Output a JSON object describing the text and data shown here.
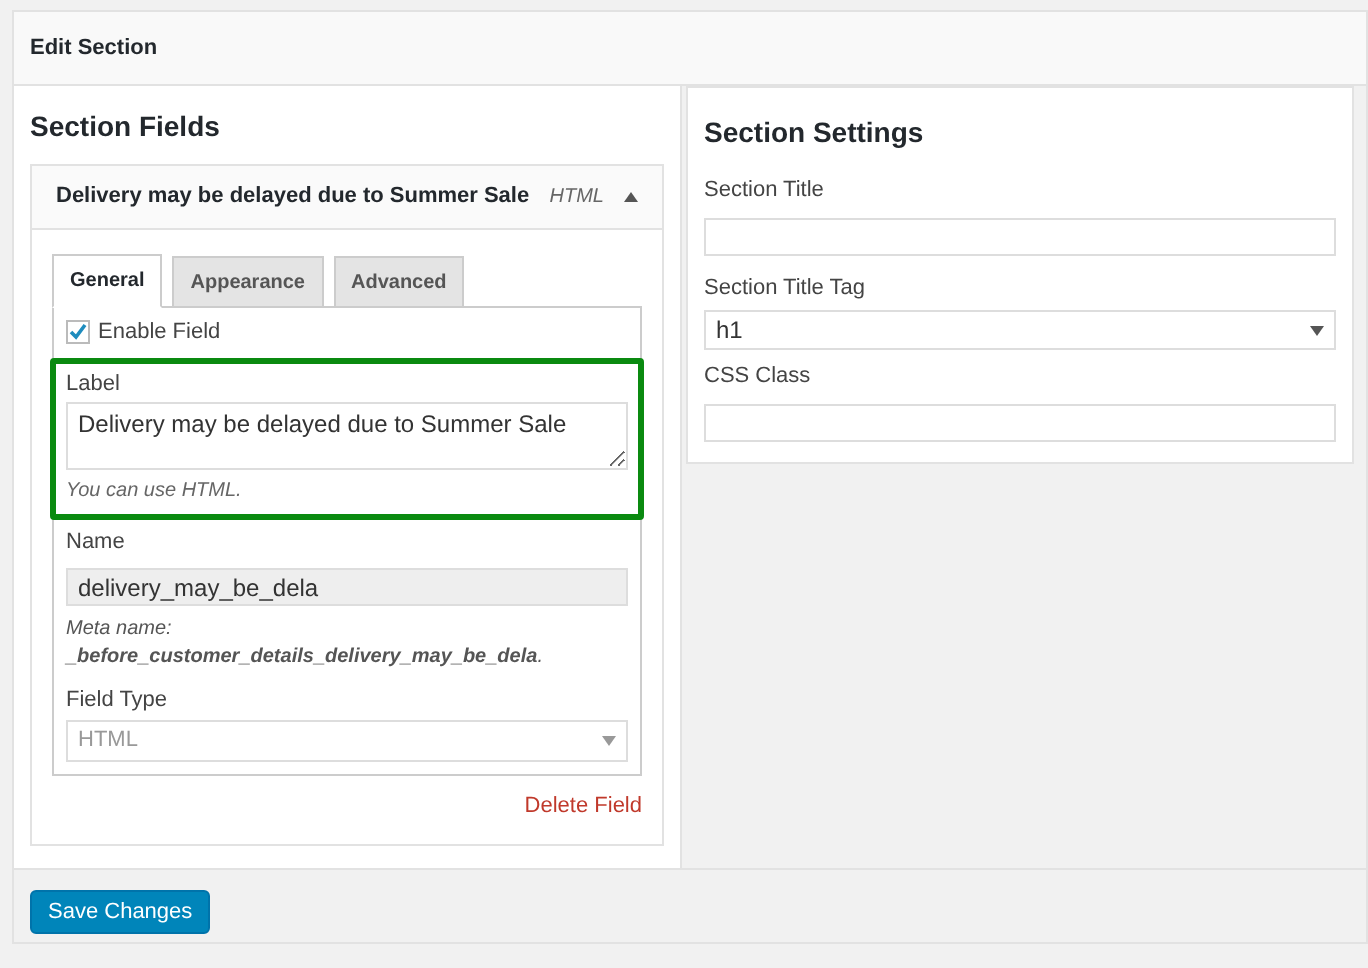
{
  "header": {
    "title": "Edit Section"
  },
  "section_fields": {
    "heading": "Section Fields",
    "field": {
      "title": "Delivery may be delayed due to Summer Sale",
      "type": "HTML",
      "expanded": true,
      "tabs": [
        {
          "label": "General",
          "selected": true
        },
        {
          "label": "Appearance",
          "selected": false
        },
        {
          "label": "Advanced",
          "selected": false
        }
      ],
      "enable_field": {
        "label": "Enable Field",
        "checked": true
      },
      "label_field": {
        "label": "Label",
        "value": "Delivery may be delayed due to Summer Sale",
        "hint": "You can use HTML.",
        "highlighted": true
      },
      "name_field": {
        "label": "Name",
        "value": "delivery_may_be_dela",
        "meta": "Meta name: **_before_customer_details_delivery_may_be_dela**."
      },
      "field_type": {
        "label": "Field Type",
        "value": "HTML",
        "disabled": true
      },
      "delete": "Delete Field"
    }
  },
  "section_settings": {
    "heading": "Section Settings",
    "fields": [
      {
        "kind": "text",
        "label": "Section Title"
      },
      {
        "kind": "select",
        "label": "Section Title Tag",
        "value": "h1"
      },
      {
        "kind": "text",
        "label": "CSS Class"
      }
    ]
  },
  "save_button": "Save Changes"
}
